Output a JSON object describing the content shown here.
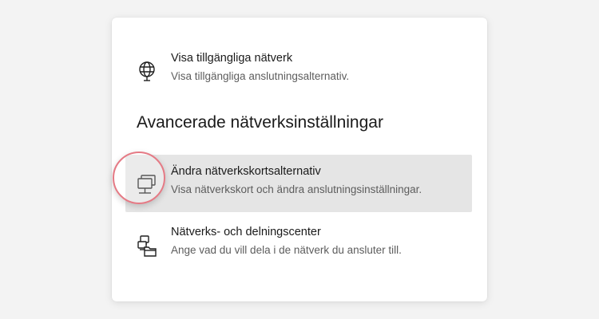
{
  "items": {
    "available_networks": {
      "title": "Visa tillgängliga nätverk",
      "description": "Visa tillgängliga anslutningsalternativ.",
      "icon": "globe-icon"
    },
    "adapter_options": {
      "title": "Ändra nätverkskortsalternativ",
      "description": "Visa nätverkskort och ändra anslutningsinställningar.",
      "icon": "network-adapter-icon"
    },
    "sharing_center": {
      "title": "Nätverks- och delningscenter",
      "description": "Ange vad du vill dela i de nätverk du ansluter till.",
      "icon": "sharing-center-icon"
    }
  },
  "section": {
    "heading": "Avancerade nätverksinställningar"
  },
  "colors": {
    "background": "#f3f3f3",
    "card": "#ffffff",
    "hover": "#e5e5e5",
    "highlight_ring": "#e57a85"
  }
}
